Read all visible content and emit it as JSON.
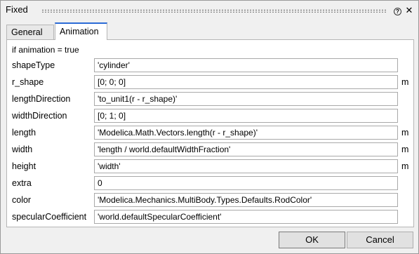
{
  "window": {
    "title": "Fixed"
  },
  "tabs": [
    {
      "label": "General"
    },
    {
      "label": "Animation"
    }
  ],
  "panel": {
    "caption": "if animation = true",
    "rows": [
      {
        "label": "shapeType",
        "value": "'cylinder'",
        "unit": ""
      },
      {
        "label": "r_shape",
        "value": "[0; 0; 0]",
        "unit": "m"
      },
      {
        "label": "lengthDirection",
        "value": "'to_unit1(r - r_shape)'",
        "unit": ""
      },
      {
        "label": "widthDirection",
        "value": "[0; 1; 0]",
        "unit": ""
      },
      {
        "label": "length",
        "value": "'Modelica.Math.Vectors.length(r - r_shape)'",
        "unit": "m"
      },
      {
        "label": "width",
        "value": "'length / world.defaultWidthFraction'",
        "unit": "m"
      },
      {
        "label": "height",
        "value": "'width'",
        "unit": "m"
      },
      {
        "label": "extra",
        "value": "0",
        "unit": ""
      },
      {
        "label": "color",
        "value": "'Modelica.Mechanics.MultiBody.Types.Defaults.RodColor'",
        "unit": ""
      },
      {
        "label": "specularCoefficient",
        "value": "'world.defaultSpecularCoefficient'",
        "unit": ""
      }
    ]
  },
  "buttons": {
    "ok": "OK",
    "cancel": "Cancel"
  },
  "icons": {
    "help": "help-icon",
    "close": "close-icon"
  }
}
